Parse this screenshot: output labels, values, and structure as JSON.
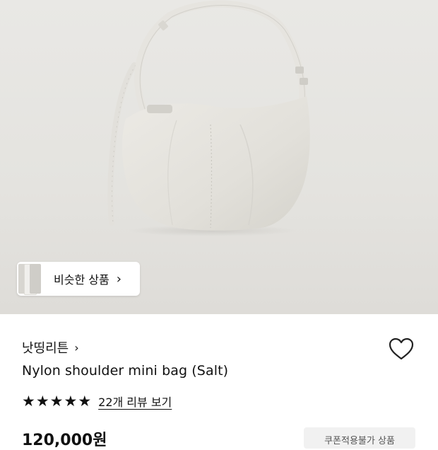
{
  "product_image": {
    "alt": "Nylon shoulder mini bag (Salt)"
  },
  "similar_products": {
    "label": "비슷한 상품",
    "chevron": "chevron-right-icon"
  },
  "product": {
    "brand": "낫띵리튼",
    "brand_chevron": "›",
    "name": "Nylon shoulder mini bag (Salt)",
    "rating": 5,
    "review_link": "22개 리뷰 보기",
    "price": "120,000원",
    "coupon_label": "쿠폰적용불가 상품"
  },
  "icons": {
    "wishlist": "heart-outline-icon",
    "star": "star-icon"
  },
  "colors": {
    "hero_background": "#e6e5e1",
    "bag": "#e3e2dc",
    "text": "#111111"
  }
}
